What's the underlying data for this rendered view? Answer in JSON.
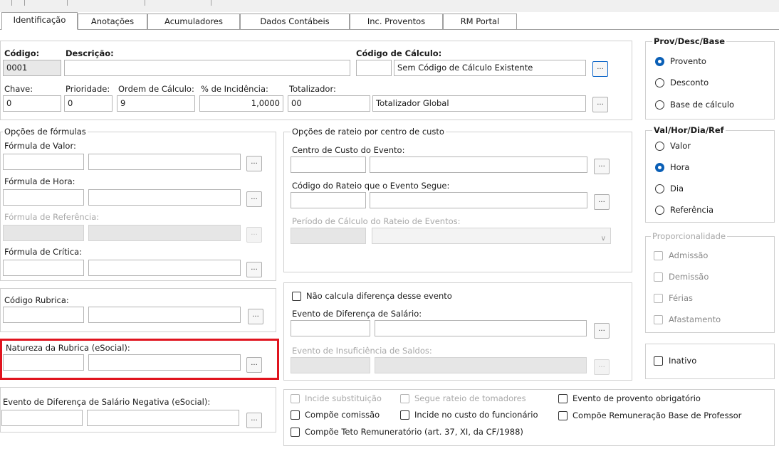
{
  "tabs": [
    "Identificação",
    "Anotações",
    "Acumuladores",
    "Dados Contábeis",
    "Inc. Proventos",
    "RM Portal"
  ],
  "header": {
    "codigo_label": "Código:",
    "codigo_value": "0001",
    "descricao_label": "Descrição:",
    "descricao_value": "",
    "codigo_calculo_label": "Código de Cálculo:",
    "codigo_calculo_code": "",
    "codigo_calculo_desc": "Sem Código de Cálculo Existente",
    "chave_label": "Chave:",
    "chave_value": "0",
    "prioridade_label": "Prioridade:",
    "prioridade_value": "0",
    "ordem_label": "Ordem de Cálculo:",
    "ordem_value": "9",
    "incidencia_label": "% de Incidência:",
    "incidencia_value": "1,0000",
    "totalizador_label": "Totalizador:",
    "totalizador_code": "00",
    "totalizador_desc": "Totalizador Global"
  },
  "formulas": {
    "title": "Opções de fórmulas",
    "valor_label": "Fórmula de Valor:",
    "hora_label": "Fórmula de Hora:",
    "referencia_label": "Fórmula de Referência:",
    "critica_label": "Fórmula de Crítica:"
  },
  "rubrica": {
    "codigo_label": "Código Rubrica:",
    "natureza_label": "Natureza da Rubrica (eSocial):",
    "negativa_label": "Evento de Diferença de Salário Negativa (eSocial):"
  },
  "rateio": {
    "title": "Opções de rateio por centro de custo",
    "centro_label": "Centro de Custo do Evento:",
    "codigo_rateio_label": "Código do Rateio que o Evento Segue:",
    "periodo_label": "Período de Cálculo do Rateio de Eventos:"
  },
  "diferenca": {
    "nao_calcula_label": "Não calcula diferença desse evento",
    "evento_dif_label": "Evento de Diferença de Salário:",
    "insuficiencia_label": "Evento de Insuficiência de Saldos:"
  },
  "prov_desc_base": {
    "title": "Prov/Desc/Base",
    "options": [
      "Provento",
      "Desconto",
      "Base de cálculo"
    ],
    "selected": "Provento"
  },
  "val_hor": {
    "title": "Val/Hor/Dia/Ref",
    "options": [
      "Valor",
      "Hora",
      "Dia",
      "Referência"
    ],
    "selected": "Hora"
  },
  "proporcionalidade": {
    "title": "Proporcionalidade",
    "options": [
      "Admissão",
      "Demissão",
      "Férias",
      "Afastamento"
    ]
  },
  "inativo_label": "Inativo",
  "bottom_checks": {
    "incide_substituicao": "Incide substituição",
    "segue_rateio": "Segue rateio de tomadores",
    "evento_obrigatorio": "Evento de provento obrigatório",
    "compoe_comissao": "Compõe comissão",
    "incide_custo": "Incide no custo do funcionário",
    "compoe_remuneracao": "Compõe Remuneração Base de Professor",
    "compoe_teto": "Compõe Teto Remuneratório (art. 37, XI, da CF/1988)"
  },
  "ellipsis": "..."
}
